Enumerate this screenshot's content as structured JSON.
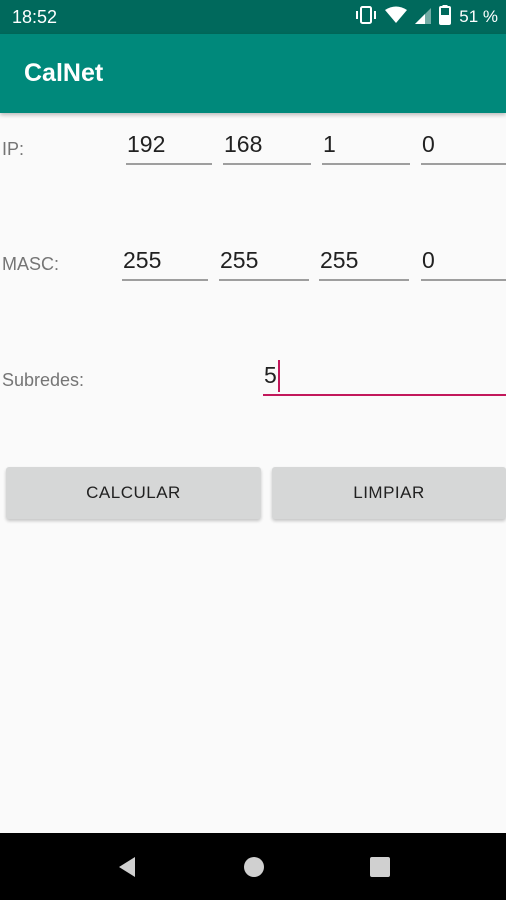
{
  "status_bar": {
    "time": "18:52",
    "battery_percent": "51 %",
    "icons": [
      "vibrate-icon",
      "wifi-icon",
      "signal-icon",
      "battery-icon"
    ]
  },
  "app_bar": {
    "title": "CalNet"
  },
  "form": {
    "ip": {
      "label": "IP:",
      "octets": [
        "192",
        "168",
        "1",
        "0"
      ]
    },
    "mask": {
      "label": "MASC:",
      "octets": [
        "255",
        "255",
        "255",
        "0"
      ]
    },
    "subnets": {
      "label": "Subredes:",
      "value": "5"
    }
  },
  "buttons": {
    "calculate": "CALCULAR",
    "clear": "LIMPIAR"
  },
  "nav_bar": {
    "icons": [
      "back-icon",
      "home-icon",
      "recents-icon"
    ]
  },
  "colors": {
    "status_bar": "#00695c",
    "app_bar": "#00897b",
    "accent": "#c2185b",
    "background": "#fafafa",
    "button": "#d6d7d7"
  }
}
